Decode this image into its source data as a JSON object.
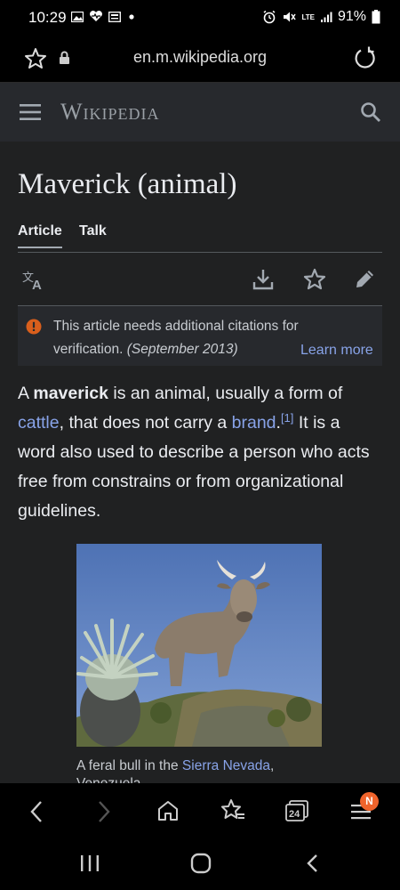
{
  "status_bar": {
    "time": "10:29",
    "network": "LTE",
    "battery": "91%"
  },
  "browser": {
    "url": "en.m.wikipedia.org",
    "tab_count": "24",
    "notification_badge": "N"
  },
  "wiki": {
    "wordmark": "Wikipedia"
  },
  "article": {
    "title": "Maverick (animal)",
    "tabs": [
      {
        "label": "Article",
        "active": true
      },
      {
        "label": "Talk",
        "active": false
      }
    ],
    "notice": {
      "line1": "This article needs additional citations for",
      "line2_prefix": "verification.",
      "line2_date": "(September 2013)",
      "learn_more": "Learn more"
    },
    "paragraph": {
      "l1_a": "A ",
      "l1_bold": "maverick",
      "l1_b": " is an animal, usually a form of",
      "l2_link1": "cattle",
      "l2_a": ", that does not carry a ",
      "l2_link2": "brand",
      "l2_b": ".",
      "l2_ref": "[1]",
      "l2_c": " It is a",
      "l3": "word also used to describe a person who acts",
      "l4": "free from constrains or from organizational",
      "l5": "guidelines."
    },
    "figure": {
      "caption_a": "A feral bull in the ",
      "caption_link": "Sierra Nevada",
      "caption_b": ",",
      "caption_line2": "Venezuela"
    }
  },
  "colors": {
    "page_bg": "#202122",
    "link": "#88a3e8",
    "warning": "#f0642c"
  },
  "icons": [
    "star-icon",
    "lock-icon",
    "reload-icon",
    "menu-icon",
    "search-icon",
    "language-icon",
    "download-icon",
    "watch-star-icon",
    "edit-pencil-icon",
    "warning-icon",
    "back-icon",
    "forward-icon",
    "home-icon",
    "bookmarks-icon",
    "tabs-icon",
    "browser-menu-icon",
    "recents-icon",
    "home-button-icon",
    "nav-back-icon"
  ]
}
